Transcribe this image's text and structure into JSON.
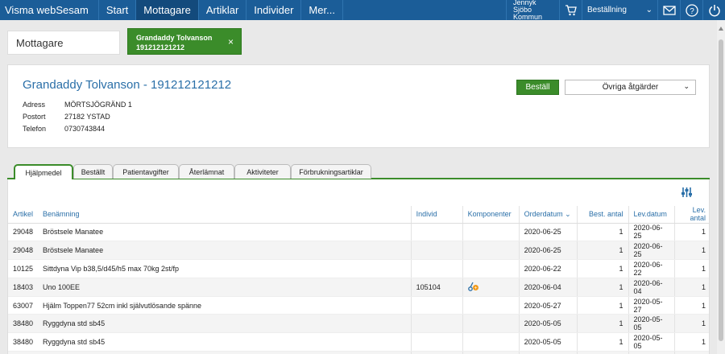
{
  "app": {
    "brand": "Visma webSesam"
  },
  "nav": {
    "items": [
      {
        "label": "Start",
        "active": false
      },
      {
        "label": "Mottagare",
        "active": true
      },
      {
        "label": "Artiklar",
        "active": false
      },
      {
        "label": "Individer",
        "active": false
      },
      {
        "label": "Mer...",
        "active": false
      }
    ],
    "user_name": "Jennyk",
    "user_org": "Sjöbo Kommun",
    "order_select": "Beställning",
    "icons": [
      "cart-icon",
      "mail-icon",
      "help-icon",
      "power-icon"
    ]
  },
  "recipient": {
    "label": "Mottagare",
    "chip_name": "Grandaddy Tolvanson",
    "chip_id": "191212121212",
    "chip_close": "×"
  },
  "patient": {
    "title": "Grandaddy Tolvanson - 191212121212",
    "address_label": "Adress",
    "address": "MÖRTSJÖGRÄND 1",
    "city_label": "Postort",
    "city": "27182 YSTAD",
    "phone_label": "Telefon",
    "phone": "0730743844",
    "order_button": "Beställ",
    "other_actions": "Övriga åtgärder"
  },
  "tabs": [
    {
      "label": "Hjälpmedel",
      "active": true
    },
    {
      "label": "Beställt",
      "active": false
    },
    {
      "label": "Patientavgifter",
      "active": false
    },
    {
      "label": "Återlämnat",
      "active": false
    },
    {
      "label": "Aktiviteter",
      "active": false
    },
    {
      "label": "Förbrukningsartiklar",
      "active": false
    }
  ],
  "table": {
    "columns": [
      "Artikel",
      "Benämning",
      "Individ",
      "Komponenter",
      "Orderdatum",
      "Best. antal",
      "Lev.datum",
      "Lev. antal"
    ],
    "sort_column": "Orderdatum",
    "sort_direction": "desc",
    "rows": [
      {
        "artikel": "29048",
        "benamning": "Bröstsele Manatee",
        "individ": "",
        "komponenter": "",
        "orderdatum": "2020-06-25",
        "best_antal": "1",
        "levdatum": "2020-06-25",
        "lev_antal": "1"
      },
      {
        "artikel": "29048",
        "benamning": "Bröstsele Manatee",
        "individ": "",
        "komponenter": "",
        "orderdatum": "2020-06-25",
        "best_antal": "1",
        "levdatum": "2020-06-25",
        "lev_antal": "1"
      },
      {
        "artikel": "10125",
        "benamning": "Sittdyna Vip b38,5/d45/h5 max 70kg 2st/fp",
        "individ": "",
        "komponenter": "",
        "orderdatum": "2020-06-22",
        "best_antal": "1",
        "levdatum": "2020-06-22",
        "lev_antal": "1"
      },
      {
        "artikel": "18403",
        "benamning": "Uno 100EE",
        "individ": "105104",
        "komponenter": "component-icon",
        "orderdatum": "2020-06-04",
        "best_antal": "1",
        "levdatum": "2020-06-04",
        "lev_antal": "1"
      },
      {
        "artikel": "63007",
        "benamning": "Hjälm Toppen77 52cm inkl självutlösande spänne",
        "individ": "",
        "komponenter": "",
        "orderdatum": "2020-05-27",
        "best_antal": "1",
        "levdatum": "2020-05-27",
        "lev_antal": "1"
      },
      {
        "artikel": "38480",
        "benamning": "Ryggdyna std sb45",
        "individ": "",
        "komponenter": "",
        "orderdatum": "2020-05-05",
        "best_antal": "1",
        "levdatum": "2020-05-05",
        "lev_antal": "1"
      },
      {
        "artikel": "38480",
        "benamning": "Ryggdyna std sb45",
        "individ": "",
        "komponenter": "",
        "orderdatum": "2020-05-05",
        "best_antal": "1",
        "levdatum": "2020-05-05",
        "lev_antal": "1"
      },
      {
        "artikel": "",
        "benamning": "",
        "individ": "",
        "komponenter": "",
        "orderdatum": "",
        "best_antal": "",
        "levdatum": "",
        "lev_antal": ""
      }
    ]
  },
  "colors": {
    "navbar": "#1b5d98",
    "accent_green": "#3b8c2a",
    "link_blue": "#2a6fa8"
  }
}
